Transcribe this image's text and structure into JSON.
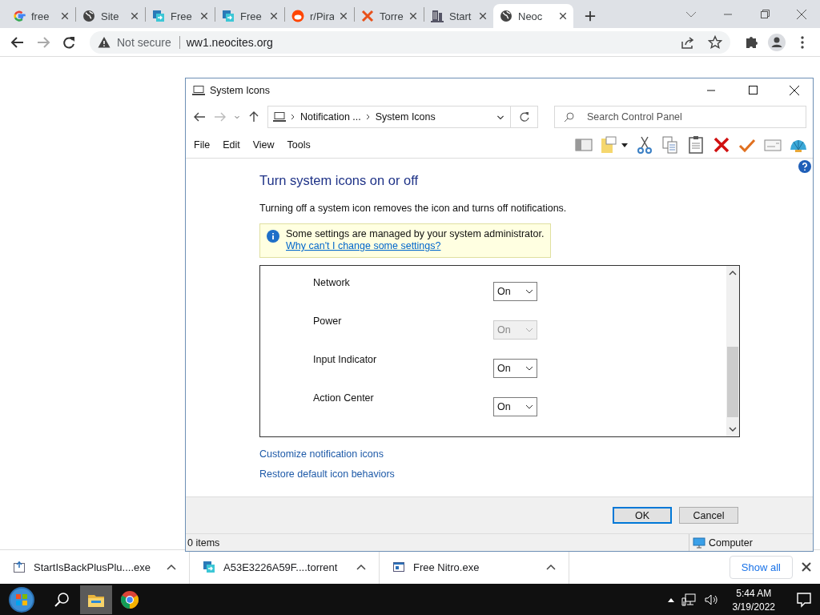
{
  "browser": {
    "tabs": [
      {
        "title": "free",
        "kind": "google",
        "selected": false
      },
      {
        "title": "Site",
        "kind": "globe",
        "selected": false
      },
      {
        "title": "Free",
        "kind": "nitro",
        "selected": false
      },
      {
        "title": "Free",
        "kind": "nitro",
        "selected": false
      },
      {
        "title": "r/Pira",
        "kind": "reddit",
        "selected": false
      },
      {
        "title": "Torre",
        "kind": "cross",
        "selected": false
      },
      {
        "title": "Start",
        "kind": "building",
        "selected": false
      },
      {
        "title": "Neoc",
        "kind": "globe",
        "selected": true
      }
    ],
    "security": "Not secure",
    "url": "ww1.neocites.org"
  },
  "dialog": {
    "title": "System Icons",
    "breadcrumb": [
      "Notification ...",
      "System Icons"
    ],
    "search_placeholder": "Search Control Panel",
    "menu": [
      "File",
      "Edit",
      "View",
      "Tools"
    ],
    "heading": "Turn system icons on or off",
    "description": "Turning off a system icon removes the icon and turns off notifications.",
    "notice": {
      "text": "Some settings are managed by your system administrator.",
      "link": "Why can't I change some settings?"
    },
    "settings": [
      {
        "name": "Network",
        "value": "On",
        "disabled": false
      },
      {
        "name": "Power",
        "value": "On",
        "disabled": true
      },
      {
        "name": "Input Indicator",
        "value": "On",
        "disabled": false
      },
      {
        "name": "Action Center",
        "value": "On",
        "disabled": false
      }
    ],
    "links": [
      "Customize notification icons",
      "Restore default icon behaviors"
    ],
    "buttons": [
      {
        "label": "OK",
        "default": true
      },
      {
        "label": "Cancel",
        "default": false
      }
    ],
    "status": {
      "items": "0 items",
      "location": "Computer"
    }
  },
  "downloads": [
    {
      "name": "StartIsBackPlusPlu....exe",
      "kind": "installer"
    },
    {
      "name": "A53E3226A59F....torrent",
      "kind": "nitro"
    },
    {
      "name": "Free Nitro.exe",
      "kind": "window"
    }
  ],
  "show_all": "Show all",
  "taskbar": {
    "apps": [
      {
        "kind": "explorer",
        "selected": true
      },
      {
        "kind": "chrome",
        "selected": false
      }
    ],
    "time": "5:44 AM",
    "date": "3/19/2022"
  }
}
